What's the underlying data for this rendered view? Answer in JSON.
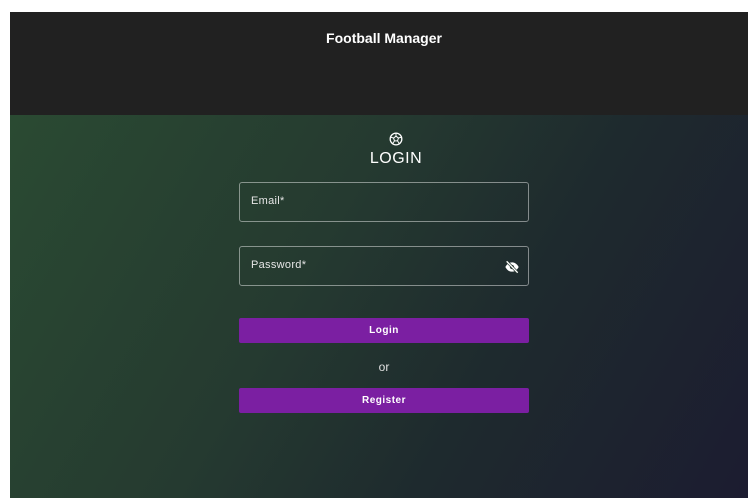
{
  "header": {
    "title": "Football Manager"
  },
  "login": {
    "logo_icon": "football-icon",
    "title": "LOGIN",
    "email": {
      "label": "Email*",
      "value": ""
    },
    "password": {
      "label": "Password*",
      "value": "",
      "toggle_icon": "eye-off-icon"
    },
    "login_button": "Login",
    "separator": "or",
    "register_button": "Register"
  },
  "colors": {
    "header_bg": "#212121",
    "button_bg": "#7b1fa2",
    "gradient_start": "#2a4a32",
    "gradient_end": "#1c1c30"
  }
}
